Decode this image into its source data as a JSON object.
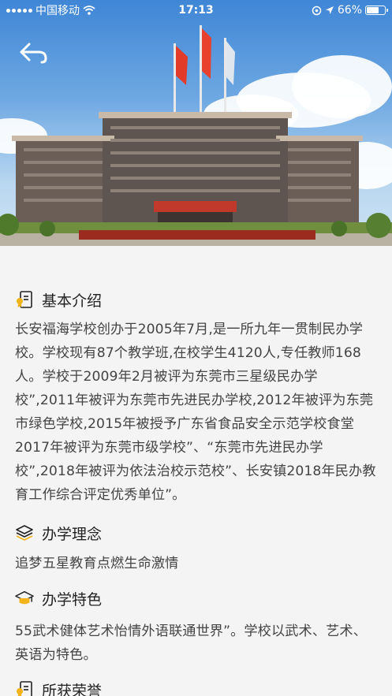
{
  "status_bar": {
    "carrier": "中国移动",
    "time": "17:13",
    "battery": "66%",
    "battery_level": 0.66
  },
  "hero": {
    "icons": [
      "back-arrow-icon"
    ]
  },
  "sections": [
    {
      "icon": "document-badge-icon",
      "title": "基本介绍",
      "text": "长安福海学校创办于2005年7月,是一所九年一贯制民办学校。学校现有87个教学班,在校学生4120人,专任教师168人。学校于2009年2月被评为东莞市三星级民办学校”,2011年被评为东莞市先进民办学校,2012年被评为东莞市绿色学校,2015年被授予广东省食品安全示范学校食堂2017年被评为东莞市级学校”、“东莞市先进民办学校”,2018年被评为依法治校示范校”、长安镇2018年民办教育工作综合评定优秀单位”。"
    },
    {
      "icon": "layers-icon",
      "title": "办学理念",
      "text": "追梦五星教育点燃生命激情"
    },
    {
      "icon": "graduation-cap-icon",
      "title": "办学特色",
      "text": "55武术健体艺术怡情外语联通世界”。学校以武术、艺术、英语为特色。"
    },
    {
      "icon": "document-badge-icon",
      "title": "所获荣誉",
      "text": ""
    }
  ]
}
